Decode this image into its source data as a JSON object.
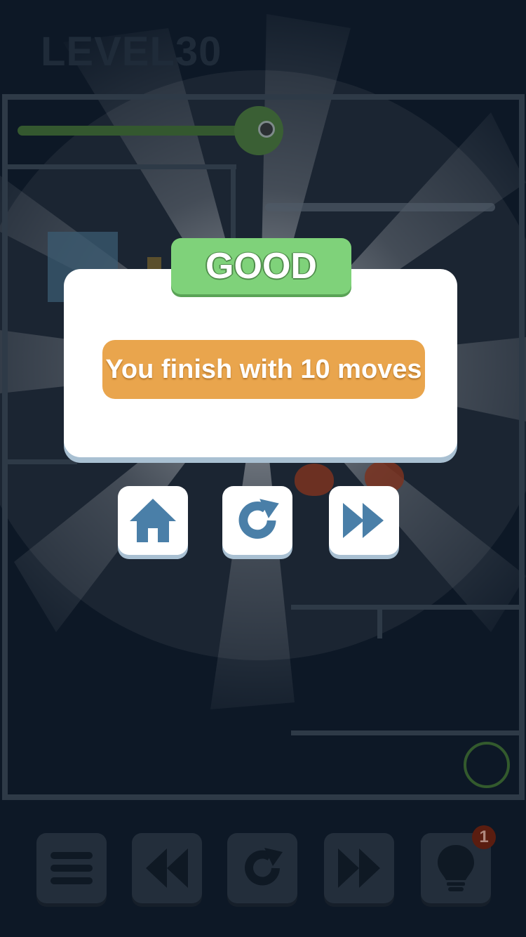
{
  "level": {
    "title": "LEVEL30"
  },
  "result": {
    "rating": "GOOD",
    "message": "You finish with 10 moves"
  },
  "actions": [
    {
      "icon": "home-icon"
    },
    {
      "icon": "restart-icon"
    },
    {
      "icon": "next-level-icon"
    }
  ],
  "toolbar": {
    "buttons": [
      {
        "icon": "menu-icon"
      },
      {
        "icon": "rewind-icon"
      },
      {
        "icon": "restart-icon"
      },
      {
        "icon": "fast-forward-icon"
      },
      {
        "icon": "lightbulb-icon"
      }
    ],
    "hint_count": "1"
  },
  "colors": {
    "background": "#0d1826",
    "accent_green": "#7fd27a",
    "accent_orange": "#e9a54d",
    "icon_blue": "#4a7fa8",
    "modal_white": "#ffffff"
  }
}
